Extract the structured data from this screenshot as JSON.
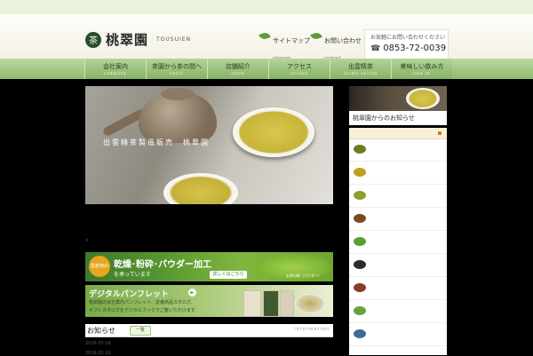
{
  "header": {
    "logo_mark": "茶",
    "logo_text": "桃翠園",
    "logo_sub": "TOUSUIEN",
    "links": [
      {
        "label": "サイトマップ",
        "sub": "sitemap"
      },
      {
        "label": "お問い合わせ",
        "sub": "contact"
      }
    ],
    "contact_prompt": "お気軽にお問い合わせください",
    "phone_icon": "☎",
    "phone": "0853-72-0039"
  },
  "nav": [
    {
      "label": "会社案内",
      "sub": "company"
    },
    {
      "label": "茶園から茶の間へ",
      "sub": "heart"
    },
    {
      "label": "店舗紹介",
      "sub": "store"
    },
    {
      "label": "アクセス",
      "sub": "access"
    },
    {
      "label": "出雲精茶",
      "sub": "izumo seicha"
    },
    {
      "label": "美味しい飲み方",
      "sub": "how to"
    }
  ],
  "hero": {
    "caption": "出雲精茶製造販売　桃翠園"
  },
  "tiny_mark": "※",
  "banner_powder": {
    "badge": "農産物の",
    "title": "乾燥･粉砕･パウダー加工",
    "sub": "を承っています",
    "button": "詳しくはこちら",
    "caption": "お茶の粉（パウダー）"
  },
  "banner_pamphlet": {
    "title": "デジタルパンフレット",
    "arrow": "►",
    "line1": "桃翠園の会社案内パンフレット、定番商品カタログ、",
    "line2": "ギフトカタログをデジタルブックでご覧いただけます"
  },
  "news": {
    "title": "お知らせ",
    "button": "一覧",
    "en": "information",
    "dates": [
      "2016.05.16",
      "2016.05.16"
    ]
  },
  "sidebar": {
    "card_caption": "桃翠園からのお知らせ",
    "item_colors": [
      "#6b7d1f",
      "#c0a020",
      "#8aa12a",
      "#7a4a22",
      "#5aa030",
      "#2b2b2b",
      "#8a3b2a",
      "#6aa23a",
      "#3c6c96"
    ]
  }
}
